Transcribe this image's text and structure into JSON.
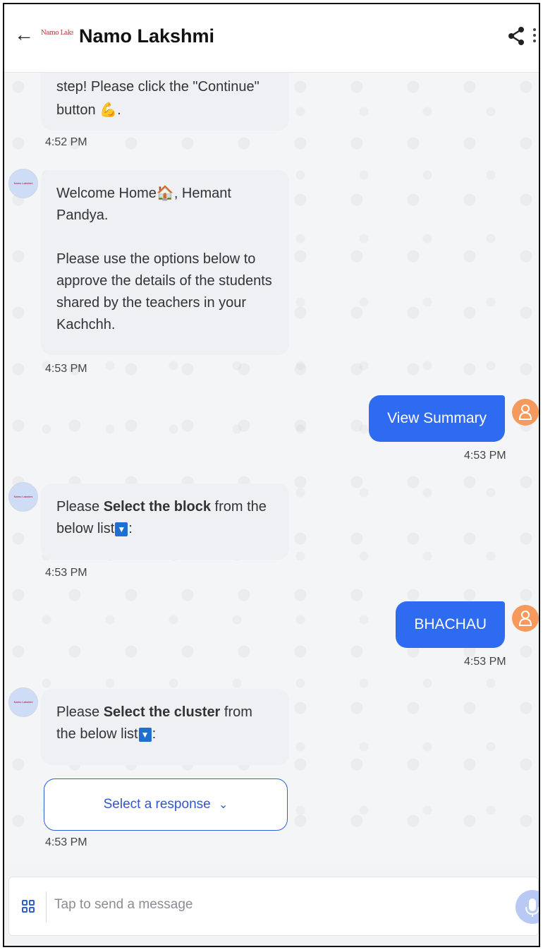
{
  "header": {
    "title": "Namo Lakshmi",
    "logo_text": "Namo Lakshmi"
  },
  "messages": {
    "m1_line1": "step! Please click the \"Continue\"",
    "m1_line2": "button",
    "m1_emoji": "💪",
    "m1_time": "4:52 PM",
    "m2_welcome_pre": "Welcome Home",
    "m2_welcome_emoji": "🏠",
    "m2_welcome_post": ", Hemant Pandya.",
    "m2_body": "Please use the options below to approve the details of the students shared by the teachers in your Kachchh.",
    "m2_time": "4:53 PM",
    "u1_text": "View Summary",
    "u1_time": "4:53 PM",
    "m3_pre": "Please ",
    "m3_bold": "Select the block",
    "m3_post": " from the below list",
    "m3_icon": "▼",
    "m3_colon": ":",
    "m3_time": "4:53 PM",
    "u2_text": "BHACHAU",
    "u2_time": "4:53 PM",
    "m4_pre": "Please ",
    "m4_bold": "Select the cluster",
    "m4_post": " from the below list",
    "m4_icon": "▼",
    "m4_colon": ":",
    "select_label": "Select a response",
    "select_chevron": "⌄",
    "m4_time": "4:53 PM"
  },
  "input": {
    "placeholder": "Tap to send a message"
  },
  "colors": {
    "user_bubble": "#2e6bf0",
    "user_avatar": "#f59a5c",
    "bot_bubble": "#eef0f3"
  }
}
